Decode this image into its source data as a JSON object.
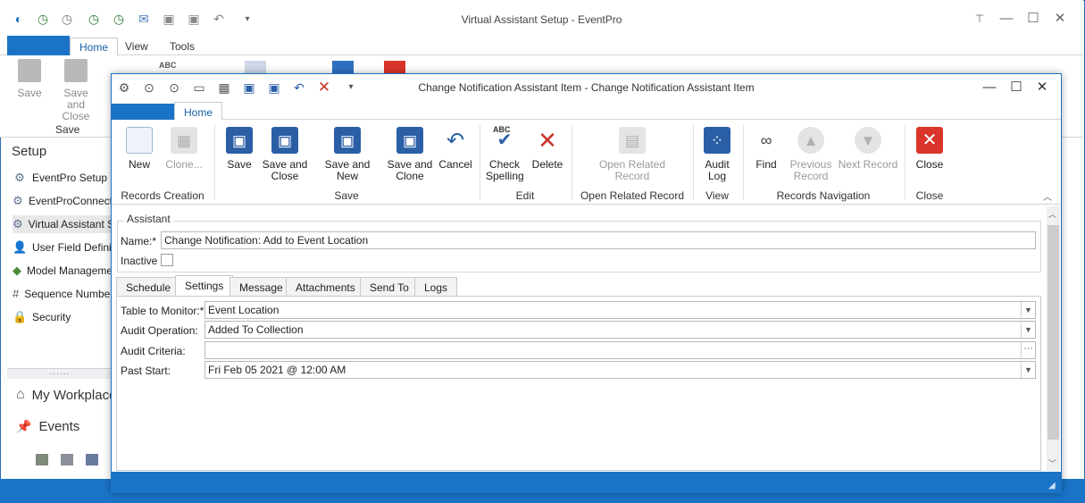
{
  "app": {
    "title": "Virtual Assistant Setup - EventPro",
    "tabs": [
      "Home",
      "View",
      "Tools"
    ],
    "ribbon": {
      "save": "Save",
      "save_and_close_1": "Save and",
      "save_and_close_2": "Close",
      "group_save": "Save",
      "abc": "ABC"
    }
  },
  "sidebar": {
    "title": "Setup",
    "items": [
      {
        "label": "EventPro Setup",
        "icon": "gears-icon"
      },
      {
        "label": "EventProConnect",
        "icon": "gears-icon"
      },
      {
        "label": "Virtual Assistant Se",
        "icon": "gears-icon"
      },
      {
        "label": "User Field Definitio",
        "icon": "user-icon"
      },
      {
        "label": "Model Managemen",
        "icon": "model-icon"
      },
      {
        "label": "Sequence Number",
        "icon": "hash-icon"
      },
      {
        "label": "Security",
        "icon": "lock-icon"
      }
    ],
    "splitter": "......",
    "workplace": "My Workplace",
    "events": "Events"
  },
  "dialog": {
    "title": "Change Notification Assistant Item - Change Notification Assistant Item",
    "tab": "Home",
    "ribbon": {
      "new": "New",
      "clone": "Clone...",
      "group_records_creation": "Records Creation",
      "save": "Save",
      "save_and_close_1": "Save and",
      "save_and_close_2": "Close",
      "save_and_new": "Save and New",
      "save_and_clone_1": "Save and",
      "save_and_clone_2": "Clone",
      "cancel": "Cancel",
      "group_save": "Save",
      "check_spelling_1": "Check",
      "check_spelling_2": "Spelling",
      "abc": "ABC",
      "delete": "Delete",
      "group_edit": "Edit",
      "open_related_1": "Open Related",
      "open_related_2": "Record",
      "group_open_related": "Open Related Record",
      "audit_log_1": "Audit",
      "audit_log_2": "Log",
      "group_view": "View",
      "find": "Find",
      "previous_1": "Previous",
      "previous_2": "Record",
      "next": "Next Record",
      "group_records_nav": "Records Navigation",
      "close": "Close",
      "group_close": "Close"
    },
    "assistant": {
      "group_label": "Assistant",
      "name_label": "Name:*",
      "name_value": "Change Notification: Add to Event Location",
      "inactive_label": "Inactive",
      "inactive_checked": false
    },
    "tabs": [
      "Schedule",
      "Settings",
      "Message",
      "Attachments",
      "Send To",
      "Logs"
    ],
    "active_tab": "Settings",
    "settings": {
      "table_label": "Table to Monitor:*",
      "table_value": "Event Location",
      "audit_op_label": "Audit Operation:",
      "audit_op_value": "Added To Collection",
      "audit_criteria_label": "Audit Criteria:",
      "audit_criteria_value": "",
      "past_start_label": "Past Start:",
      "past_start_value": "Fri Feb 05 2021 @ 12:00 AM"
    }
  },
  "colors": {
    "accent": "#1a73c7",
    "close_red": "#d9352b"
  }
}
